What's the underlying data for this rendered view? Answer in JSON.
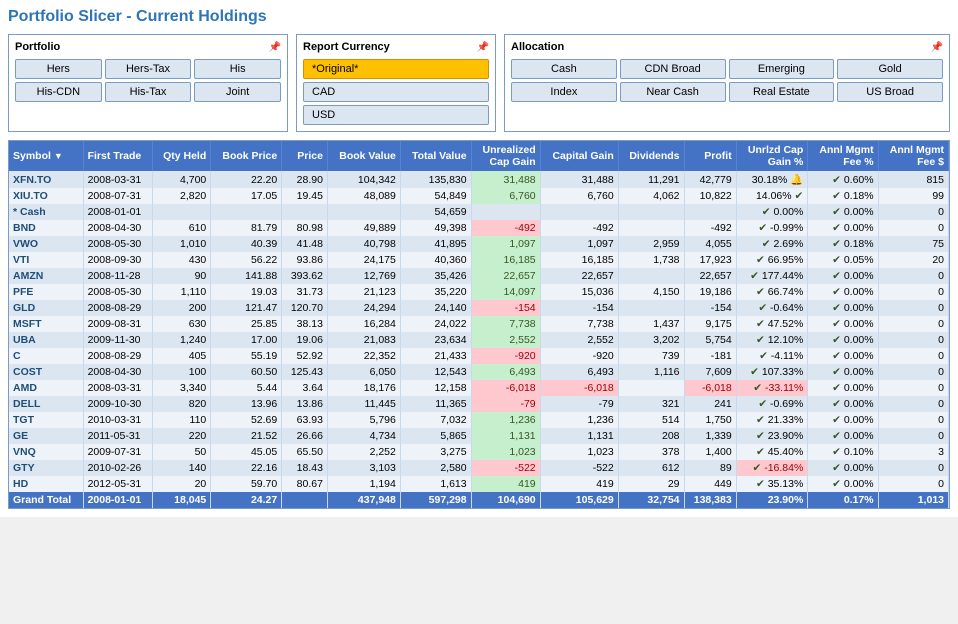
{
  "title": "Portfolio Slicer - Current Holdings",
  "portfolio": {
    "label": "Portfolio",
    "buttons": [
      "Hers",
      "Hers-Tax",
      "His",
      "His-CDN",
      "His-Tax",
      "Joint"
    ]
  },
  "currency": {
    "label": "Report Currency",
    "options": [
      "*Original*",
      "CAD",
      "USD"
    ]
  },
  "allocation": {
    "label": "Allocation",
    "buttons": [
      "Cash",
      "CDN Broad",
      "Emerging",
      "Gold",
      "Index",
      "Near Cash",
      "Real Estate",
      "US Broad"
    ]
  },
  "table": {
    "headers": [
      "Symbol",
      "First Trade",
      "Qty Held",
      "Book Price",
      "Price",
      "Book Value",
      "Total Value",
      "Unrealized Cap Gain",
      "Capital Gain",
      "Dividends",
      "Profit",
      "Unrlzd Cap Gain %",
      "Annl Mgmt Fee %",
      "Annl Mgmt Fee $"
    ],
    "rows": [
      [
        "XFN.TO",
        "2008-03-31",
        "4,700",
        "22.20",
        "28.90",
        "104,342",
        "135,830",
        "31,488",
        "31,488",
        "11,291",
        "42,779",
        "30.18%",
        "0.60%",
        "815",
        "pos",
        "pos"
      ],
      [
        "XIU.TO",
        "2008-07-31",
        "2,820",
        "17.05",
        "19.45",
        "48,089",
        "54,849",
        "6,760",
        "6,760",
        "4,062",
        "10,822",
        "14.06%",
        "0.18%",
        "99",
        "pos",
        "pos"
      ],
      [
        "* Cash",
        "2008-01-01",
        "",
        "",
        "",
        "",
        "54,659",
        "",
        "",
        "",
        "",
        "0.00%",
        "0.00%",
        "0",
        "",
        ""
      ],
      [
        "BND",
        "2008-04-30",
        "610",
        "81.79",
        "80.98",
        "49,889",
        "49,398",
        "-492",
        "-492",
        "",
        "-492",
        "-0.99%",
        "0.00%",
        "0",
        "neg",
        "neg"
      ],
      [
        "VWO",
        "2008-05-30",
        "1,010",
        "40.39",
        "41.48",
        "40,798",
        "41,895",
        "1,097",
        "1,097",
        "2,959",
        "4,055",
        "2.69%",
        "0.18%",
        "75",
        "pos",
        "pos"
      ],
      [
        "VTI",
        "2008-09-30",
        "430",
        "56.22",
        "93.86",
        "24,175",
        "40,360",
        "16,185",
        "16,185",
        "1,738",
        "17,923",
        "66.95%",
        "0.05%",
        "20",
        "pos",
        "pos"
      ],
      [
        "AMZN",
        "2008-11-28",
        "90",
        "141.88",
        "393.62",
        "12,769",
        "35,426",
        "22,657",
        "22,657",
        "",
        "22,657",
        "177.44%",
        "0.00%",
        "0",
        "pos",
        "pos"
      ],
      [
        "PFE",
        "2008-05-30",
        "1,110",
        "19.03",
        "31.73",
        "21,123",
        "35,220",
        "14,097",
        "15,036",
        "4,150",
        "19,186",
        "66.74%",
        "0.00%",
        "0",
        "pos",
        "pos"
      ],
      [
        "GLD",
        "2008-08-29",
        "200",
        "121.47",
        "120.70",
        "24,294",
        "24,140",
        "-154",
        "-154",
        "",
        "-154",
        "-0.64%",
        "0.00%",
        "0",
        "neg",
        "neg"
      ],
      [
        "MSFT",
        "2009-08-31",
        "630",
        "25.85",
        "38.13",
        "16,284",
        "24,022",
        "7,738",
        "7,738",
        "1,437",
        "9,175",
        "47.52%",
        "0.00%",
        "0",
        "pos",
        "pos"
      ],
      [
        "UBA",
        "2009-11-30",
        "1,240",
        "17.00",
        "19.06",
        "21,083",
        "23,634",
        "2,552",
        "2,552",
        "3,202",
        "5,754",
        "12.10%",
        "0.00%",
        "0",
        "pos",
        "pos"
      ],
      [
        "C",
        "2008-08-29",
        "405",
        "55.19",
        "52.92",
        "22,352",
        "21,433",
        "-920",
        "-920",
        "739",
        "-181",
        "-4.11%",
        "0.00%",
        "0",
        "neg",
        "neg"
      ],
      [
        "COST",
        "2008-04-30",
        "100",
        "60.50",
        "125.43",
        "6,050",
        "12,543",
        "6,493",
        "6,493",
        "1,116",
        "7,609",
        "107.33%",
        "0.00%",
        "0",
        "pos",
        "pos"
      ],
      [
        "AMD",
        "2008-03-31",
        "3,340",
        "5.44",
        "3.64",
        "18,176",
        "12,158",
        "-6,018",
        "-6,018",
        "",
        "-6,018",
        "-33.11%",
        "0.00%",
        "0",
        "neg",
        "neg"
      ],
      [
        "DELL",
        "2009-10-30",
        "820",
        "13.96",
        "13.86",
        "11,445",
        "11,365",
        "-79",
        "-79",
        "321",
        "241",
        "-0.69%",
        "0.00%",
        "0",
        "neg",
        "pos"
      ],
      [
        "TGT",
        "2010-03-31",
        "110",
        "52.69",
        "63.93",
        "5,796",
        "7,032",
        "1,236",
        "1,236",
        "514",
        "1,750",
        "21.33%",
        "0.00%",
        "0",
        "pos",
        "pos"
      ],
      [
        "GE",
        "2011-05-31",
        "220",
        "21.52",
        "26.66",
        "4,734",
        "5,865",
        "1,131",
        "1,131",
        "208",
        "1,339",
        "23.90%",
        "0.00%",
        "0",
        "pos",
        "pos"
      ],
      [
        "VNQ",
        "2009-07-31",
        "50",
        "45.05",
        "65.50",
        "2,252",
        "3,275",
        "1,023",
        "1,023",
        "378",
        "1,400",
        "45.40%",
        "0.10%",
        "3",
        "pos",
        "pos"
      ],
      [
        "GTY",
        "2010-02-26",
        "140",
        "22.16",
        "18.43",
        "3,103",
        "2,580",
        "-522",
        "-522",
        "612",
        "89",
        "-16.84%",
        "0.00%",
        "0",
        "neg",
        "pos"
      ],
      [
        "HD",
        "2012-05-31",
        "20",
        "59.70",
        "80.67",
        "1,194",
        "1,613",
        "419",
        "419",
        "29",
        "449",
        "35.13%",
        "0.00%",
        "0",
        "pos",
        "pos"
      ]
    ],
    "footer": [
      "Grand Total",
      "2008-01-01",
      "18,045",
      "24.27",
      "",
      "437,948",
      "597,298",
      "104,690",
      "105,629",
      "32,754",
      "138,383",
      "23.90%",
      "0.17%",
      "1,013"
    ]
  }
}
